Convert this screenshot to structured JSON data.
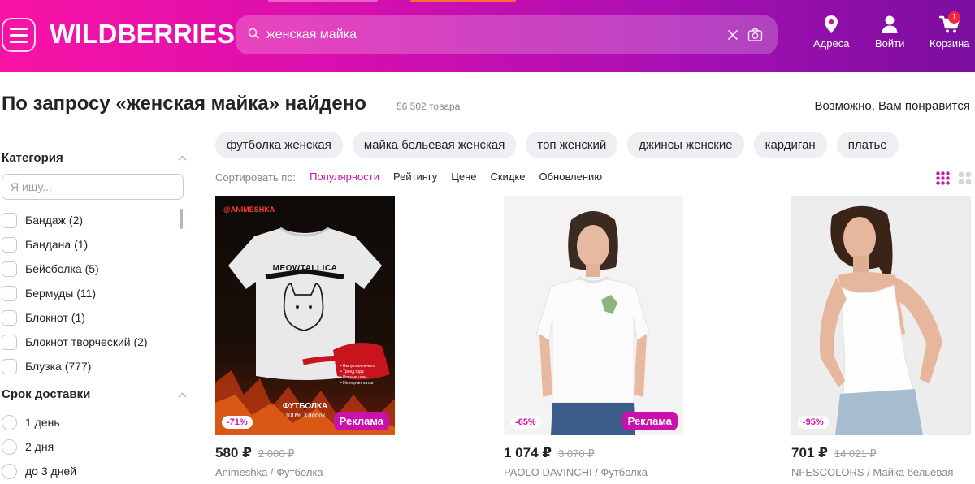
{
  "header": {
    "logo": "WILDBERRIES",
    "search_value": "женская майка",
    "nav": [
      {
        "label": "Адреса",
        "icon": "location-pin-icon"
      },
      {
        "label": "Войти",
        "icon": "user-icon"
      },
      {
        "label": "Корзина",
        "icon": "cart-icon",
        "badge": "1"
      }
    ],
    "colors": {
      "gradient_start": "#f813a5",
      "gradient_end": "#7a0e9f"
    }
  },
  "results": {
    "title": "По запросу «женская майка» найдено",
    "count": "56 502 товара",
    "suggest_label": "Возможно, Вам понравится"
  },
  "sidebar": {
    "category_title": "Категория",
    "search_placeholder": "Я ищу...",
    "categories": [
      "Бандаж (2)",
      "Бандана (1)",
      "Бейсболка (5)",
      "Бермуды (11)",
      "Блокнот (1)",
      "Блокнот творческий (2)",
      "Блузка (777)"
    ],
    "delivery_title": "Срок доставки",
    "delivery": [
      "1 день",
      "2 дня",
      "до 3 дней"
    ]
  },
  "chips": [
    "футболка женская",
    "майка бельевая женская",
    "топ женский",
    "джинсы женские",
    "кардиган",
    "платье"
  ],
  "sort": {
    "label": "Сортировать по:",
    "options": [
      "Популярности",
      "Рейтингу",
      "Цене",
      "Скидке",
      "Обновлению"
    ],
    "active": "Популярности"
  },
  "products": [
    {
      "discount": "-71%",
      "ad": "Реклама",
      "price": "580 ₽",
      "old_price": "2 000 ₽",
      "brand": "Animeshka / Футболка",
      "image_text": {
        "brand": "@ANIMESHKA",
        "print": "MEOWTALLICA",
        "caption": "ФУТБОЛКА",
        "material": "100% Хлопок",
        "features": [
          "• Выпуклая печать",
          "• Тренд года",
          "• Ровные швы",
          "• Не порчит катки"
        ]
      }
    },
    {
      "discount": "-65%",
      "ad": "Реклама",
      "price": "1 074 ₽",
      "old_price": "3 070 ₽",
      "brand": "PAOLO DAVINCHI / Футболка"
    },
    {
      "discount": "-95%",
      "price": "701 ₽",
      "old_price": "14 021 ₽",
      "brand": "NFESCOLORS / Майка бельевая"
    }
  ],
  "accent_color": "#cb11ab"
}
